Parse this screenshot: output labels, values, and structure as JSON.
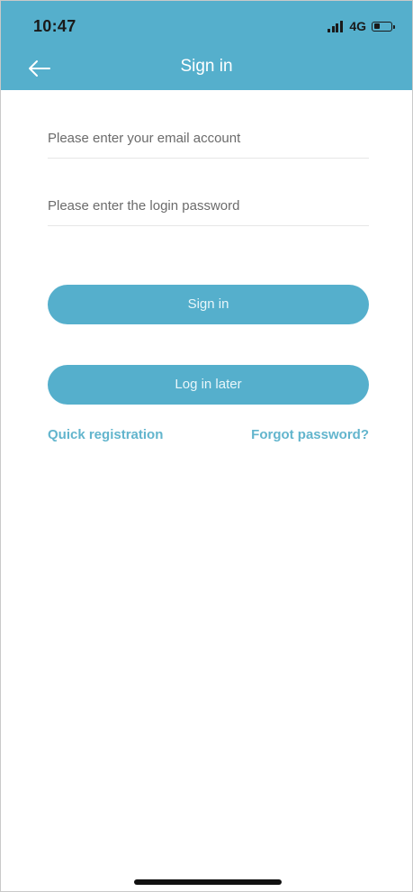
{
  "status_bar": {
    "time": "10:47",
    "network": "4G",
    "battery_level": 0.4
  },
  "header": {
    "title": "Sign in",
    "back_icon": "arrow-left-icon"
  },
  "form": {
    "email_placeholder": "Please enter your email account",
    "email_value": "",
    "password_placeholder": "Please enter the login password",
    "password_value": ""
  },
  "buttons": {
    "sign_in": "Sign in",
    "log_in_later": "Log in later"
  },
  "links": {
    "quick_registration": "Quick registration",
    "forgot_password": "Forgot password?"
  },
  "colors": {
    "accent": "#55afcc",
    "link": "#62b5cd"
  }
}
